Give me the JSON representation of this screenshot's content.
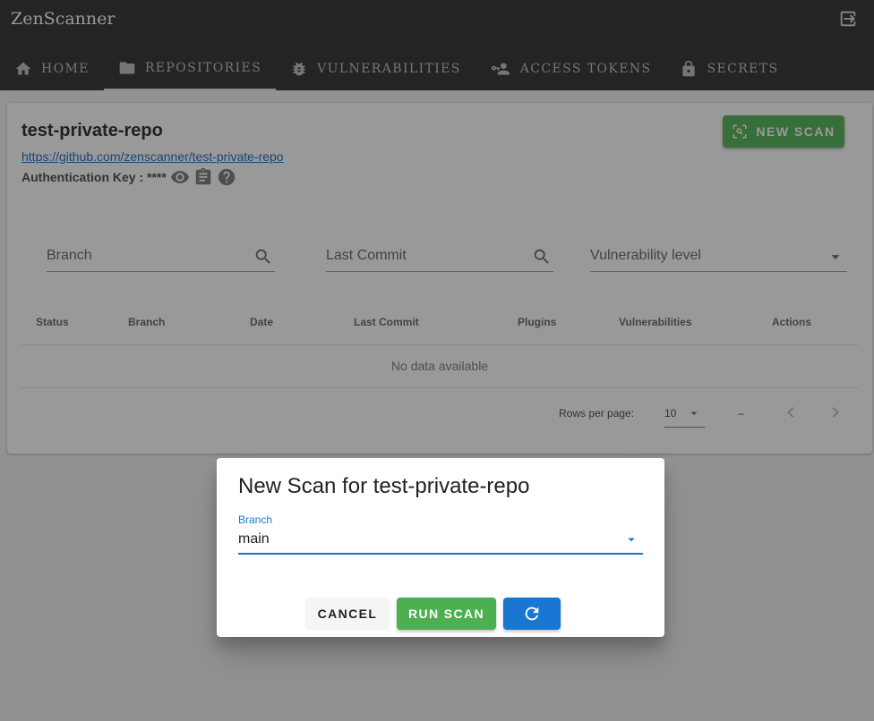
{
  "app": {
    "title": "ZenScanner"
  },
  "nav": {
    "tabs": [
      {
        "label": "HOME",
        "icon": "home-icon"
      },
      {
        "label": "REPOSITORIES",
        "icon": "folder-icon",
        "active": true
      },
      {
        "label": "VULNERABILITIES",
        "icon": "bug-icon"
      },
      {
        "label": "ACCESS TOKENS",
        "icon": "account-key-icon"
      },
      {
        "label": "SECRETS",
        "icon": "lock-icon"
      }
    ],
    "logout_icon": "logout-icon"
  },
  "repo": {
    "name": "test-private-repo",
    "url": "https://github.com/zenscanner/test-private-repo",
    "auth_label": "Authentication Key : ****",
    "new_scan_label": "NEW SCAN"
  },
  "filters": {
    "branch_placeholder": "Branch",
    "commit_placeholder": "Last Commit",
    "vuln_placeholder": "Vulnerability level"
  },
  "table": {
    "headers": [
      "Status",
      "Branch",
      "Date",
      "Last Commit",
      "Plugins",
      "Vulnerabilities",
      "Actions"
    ],
    "empty_text": "No data available",
    "rows_per_page_label": "Rows per page:",
    "rows_per_page_value": "10",
    "range_text": "–"
  },
  "dialog": {
    "title": "New Scan for test-private-repo",
    "branch_label": "Branch",
    "branch_value": "main",
    "cancel_label": "CANCEL",
    "run_label": "RUN SCAN"
  },
  "colors": {
    "appbar": "#272727",
    "success": "#4caf50",
    "primary": "#1976d2",
    "link": "#1565c0"
  }
}
